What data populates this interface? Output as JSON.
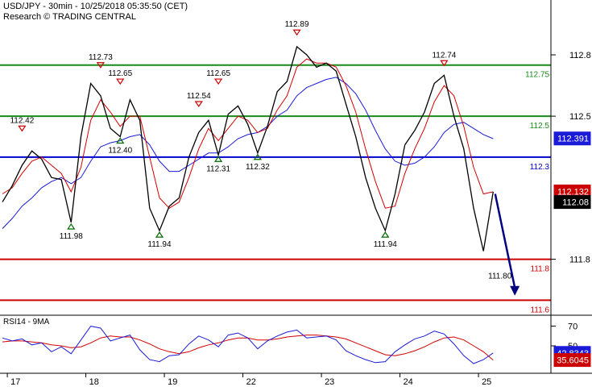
{
  "header": {
    "title": "USD/JPY - 30min - 10/25/2018 05:35:50 (CET)",
    "research": "Research © TRADING CENTRAL"
  },
  "colors": {
    "price": "#000000",
    "ma_fast": "#d40000",
    "ma_slow": "#1a1ad8",
    "resistance": "#1a8a1a",
    "pivot": "#0000cc",
    "support": "#cc0000",
    "arrow": "#000080",
    "last_price_box": "#000000",
    "ma_fast_box": "#cc0000",
    "ma_slow_box": "#1a1ad8",
    "rsi_box": "#1a1ad8",
    "rsi_ma_box": "#cc0000"
  },
  "chart_data": [
    {
      "type": "line",
      "name": "price",
      "x": [
        "17",
        "18",
        "19",
        "22",
        "23",
        "24",
        "25"
      ],
      "x_ticks": [
        {
          "label": "17",
          "pos": 0.5
        },
        {
          "label": "18",
          "pos": 8.5
        },
        {
          "label": "19",
          "pos": 16.5
        },
        {
          "label": "22",
          "pos": 24.5
        },
        {
          "label": "23",
          "pos": 32.5
        },
        {
          "label": "24",
          "pos": 40.5
        },
        {
          "label": "25",
          "pos": 48.5
        }
      ],
      "x_range": [
        0,
        53.5
      ],
      "ylim": [
        111.55,
        112.95
      ],
      "y_ticks": [
        112.8,
        112.5,
        111.8
      ],
      "series": [
        {
          "values": [
            112.08,
            112.16,
            112.26,
            112.33,
            112.29,
            112.2,
            112.19,
            111.98,
            112.4,
            112.66,
            112.6,
            112.44,
            112.4,
            112.58,
            112.48,
            112.05,
            111.94,
            112.06,
            112.1,
            112.3,
            112.42,
            112.48,
            112.31,
            112.51,
            112.55,
            112.46,
            112.32,
            112.45,
            112.62,
            112.67,
            112.84,
            112.8,
            112.74,
            112.76,
            112.72,
            112.56,
            112.4,
            112.2,
            112.05,
            111.94,
            112.12,
            112.36,
            112.43,
            112.52,
            112.66,
            112.7,
            112.5,
            112.34,
            112.05,
            111.84,
            112.13
          ]
        },
        {
          "values": [
            112.12,
            112.15,
            112.22,
            112.28,
            112.3,
            112.26,
            112.22,
            112.13,
            112.25,
            112.48,
            112.58,
            112.52,
            112.45,
            112.5,
            112.5,
            112.3,
            112.1,
            112.05,
            112.08,
            112.2,
            112.34,
            112.44,
            112.38,
            112.44,
            112.5,
            112.48,
            112.42,
            112.44,
            112.53,
            112.6,
            112.74,
            112.78,
            112.76,
            112.76,
            112.74,
            112.65,
            112.52,
            112.34,
            112.18,
            112.05,
            112.06,
            112.22,
            112.34,
            112.44,
            112.57,
            112.65,
            112.6,
            112.45,
            112.25,
            112.12,
            112.13
          ]
        },
        {
          "values": [
            111.95,
            112.0,
            112.06,
            112.1,
            112.15,
            112.18,
            112.2,
            112.17,
            112.2,
            112.28,
            112.35,
            112.37,
            112.38,
            112.4,
            112.41,
            112.36,
            112.28,
            112.23,
            112.23,
            112.26,
            112.29,
            112.32,
            112.32,
            112.35,
            112.39,
            112.41,
            112.42,
            112.45,
            112.5,
            112.53,
            112.6,
            112.64,
            112.66,
            112.68,
            112.69,
            112.66,
            112.61,
            112.53,
            112.43,
            112.34,
            112.28,
            112.26,
            112.27,
            112.3,
            112.35,
            112.42,
            112.46,
            112.47,
            112.44,
            112.41,
            112.39
          ]
        }
      ],
      "levels": {
        "resistance": [
          112.75,
          112.5
        ],
        "pivot": [
          112.3
        ],
        "support": [
          111.8,
          111.6
        ]
      },
      "level_labels": [
        "112.75",
        "112.5",
        "112.3",
        "111.8",
        "111.6"
      ],
      "tags": {
        "last_price": "112.08",
        "ma_fast": "112.132",
        "ma_slow": "112.391"
      },
      "annotations": [
        {
          "text": "112.42",
          "i": 2,
          "y": 112.42,
          "kind": "high"
        },
        {
          "text": "112.73",
          "i": 10,
          "y": 112.73,
          "kind": "high"
        },
        {
          "text": "112.65",
          "i": 12,
          "y": 112.65,
          "kind": "high"
        },
        {
          "text": "112.54",
          "i": 20,
          "y": 112.54,
          "kind": "high"
        },
        {
          "text": "112.65",
          "i": 22,
          "y": 112.65,
          "kind": "high"
        },
        {
          "text": "112.89",
          "i": 30,
          "y": 112.89,
          "kind": "high"
        },
        {
          "text": "112.74",
          "i": 45,
          "y": 112.74,
          "kind": "high"
        },
        {
          "text": "111.98",
          "i": 7,
          "y": 111.98,
          "kind": "low"
        },
        {
          "text": "112.40",
          "i": 12,
          "y": 112.4,
          "kind": "low"
        },
        {
          "text": "111.94",
          "i": 16,
          "y": 111.94,
          "kind": "low"
        },
        {
          "text": "112.31",
          "i": 22,
          "y": 112.31,
          "kind": "low"
        },
        {
          "text": "112.32",
          "i": 26,
          "y": 112.32,
          "kind": "low"
        },
        {
          "text": "111.94",
          "i": 39,
          "y": 111.94,
          "kind": "low"
        },
        {
          "text": "111.80",
          "i": 49,
          "y": 111.8,
          "kind": "low_plain"
        }
      ],
      "forecast_arrow": {
        "from": [
          50.2,
          112.12
        ],
        "to": [
          52.2,
          111.63
        ]
      }
    },
    {
      "type": "line",
      "name": "RSI14 - 9MA",
      "label": "RSI14 - 9MA",
      "ylim": [
        23,
        77
      ],
      "y_ticks": [
        70,
        50
      ],
      "series": [
        {
          "values": [
            58,
            55,
            57,
            51,
            53,
            44,
            49,
            42,
            56,
            70,
            68,
            55,
            58,
            61,
            46,
            36,
            34,
            40,
            41,
            52,
            60,
            56,
            49,
            61,
            63,
            58,
            47,
            55,
            60,
            64,
            66,
            58,
            59,
            60,
            56,
            45,
            40,
            36,
            33,
            34,
            44,
            51,
            57,
            60,
            65,
            62,
            52,
            40,
            32,
            36,
            42.8343
          ]
        },
        {
          "values": [
            54,
            55,
            55,
            54,
            53,
            51,
            50,
            48,
            49,
            53,
            58,
            60,
            59,
            59,
            56,
            52,
            47,
            44,
            42,
            44,
            48,
            51,
            53,
            56,
            58,
            58,
            56,
            56,
            57,
            59,
            60,
            61,
            61,
            60,
            59,
            57,
            53,
            49,
            45,
            41,
            40,
            42,
            45,
            49,
            54,
            58,
            59,
            56,
            50,
            44,
            35.6045
          ]
        }
      ],
      "tags": {
        "rsi": "42.8343",
        "rsi_ma": "35.6045"
      }
    }
  ]
}
